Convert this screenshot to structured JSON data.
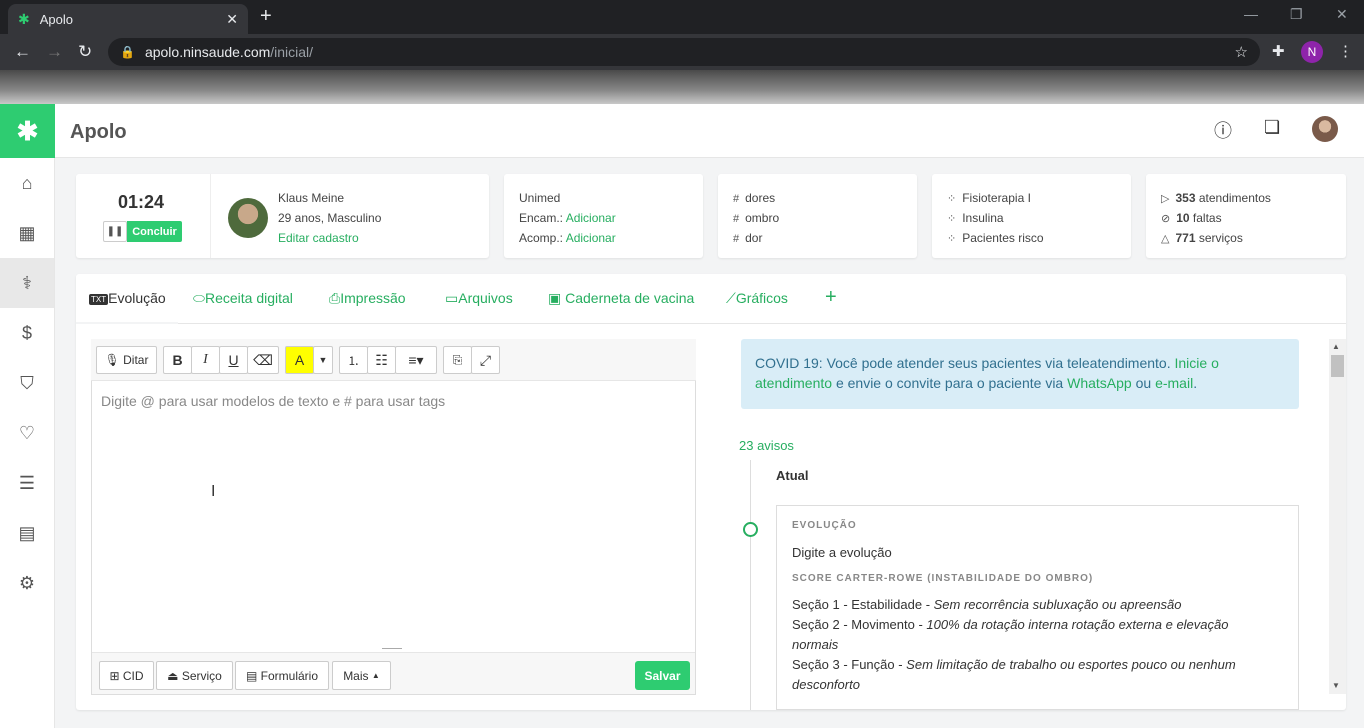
{
  "browser": {
    "tab_title": "Apolo",
    "url_host": "apolo.ninsaude.com",
    "url_path": "/inicial/",
    "profile_initial": "N"
  },
  "app": {
    "name": "Apolo"
  },
  "session": {
    "timer": "01:24",
    "conclude_label": "Concluir"
  },
  "patient": {
    "name": "Klaus Meine",
    "details": "29 anos, Masculino",
    "edit_link": "Editar cadastro"
  },
  "insurance": {
    "plan": "Unimed",
    "encam_label": "Encam.:",
    "encam_action": "Adicionar",
    "acomp_label": "Acomp.:",
    "acomp_action": "Adicionar"
  },
  "tags": [
    "dores",
    "ombro",
    "dor"
  ],
  "groups": [
    "Fisioterapia I",
    "Insulina",
    "Pacientes risco"
  ],
  "stats": [
    {
      "value": "353",
      "label": "atendimentos"
    },
    {
      "value": "10",
      "label": "faltas"
    },
    {
      "value": "771",
      "label": "serviços"
    }
  ],
  "tabs": [
    "Evolução",
    "Receita digital",
    "Impressão",
    "Arquivos",
    "Caderneta de vacina",
    "Gráficos"
  ],
  "editor": {
    "dictate_label": "Ditar",
    "placeholder": "Digite @ para usar modelos de texto e # para usar tags",
    "footer": {
      "cid": "CID",
      "servico": "Serviço",
      "formulario": "Formulário",
      "mais": "Mais",
      "salvar": "Salvar"
    }
  },
  "notice": {
    "text1": "COVID 19: Você pode atender seus pacientes via teleatendimento.",
    "link1": "Inicie o atendimento",
    "text2": "e envie o convite para o paciente via",
    "link2": "WhatsApp",
    "text3": "ou",
    "link3": "e-mail",
    "text4": "."
  },
  "timeline": {
    "avisos": "23 avisos",
    "current": "Atual",
    "evolucao_label": "EVOLUÇÃO",
    "evolucao_text": "Digite a evolução",
    "score_label": "SCORE CARTER-ROWE (INSTABILIDADE DO OMBRO)",
    "sections": [
      {
        "title": "Seção 1 - Estabilidade - ",
        "value": "Sem recorrência subluxação ou apreensão"
      },
      {
        "title": "Seção 2 - Movimento - ",
        "value": "100% da rotação interna rotação externa e elevação normais"
      },
      {
        "title": "Seção 3 - Função - ",
        "value": "Sem limitação de trabalho ou esportes pouco ou nenhum desconforto"
      }
    ]
  },
  "colors": {
    "accent": "#2ecc71",
    "link": "#27ae60",
    "notice_bg": "#d9edf7"
  }
}
